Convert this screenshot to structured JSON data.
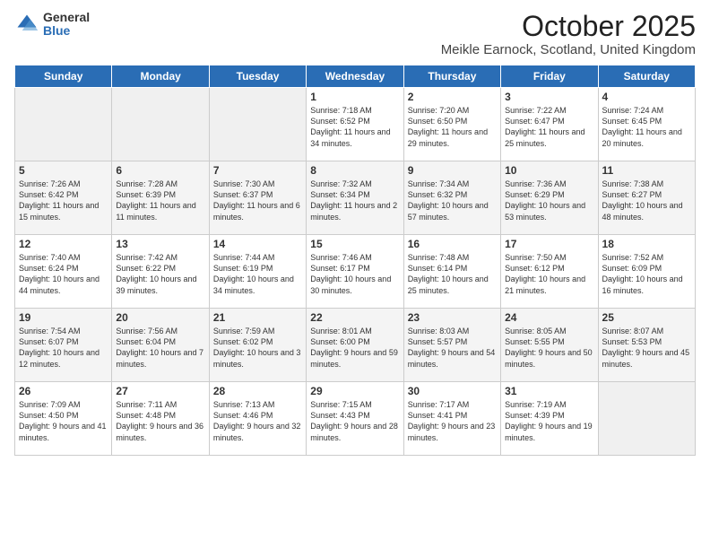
{
  "header": {
    "logo_general": "General",
    "logo_blue": "Blue",
    "month_title": "October 2025",
    "location": "Meikle Earnock, Scotland, United Kingdom"
  },
  "days_of_week": [
    "Sunday",
    "Monday",
    "Tuesday",
    "Wednesday",
    "Thursday",
    "Friday",
    "Saturday"
  ],
  "weeks": [
    [
      {
        "date": "",
        "text": ""
      },
      {
        "date": "",
        "text": ""
      },
      {
        "date": "",
        "text": ""
      },
      {
        "date": "1",
        "text": "Sunrise: 7:18 AM\nSunset: 6:52 PM\nDaylight: 11 hours\nand 34 minutes."
      },
      {
        "date": "2",
        "text": "Sunrise: 7:20 AM\nSunset: 6:50 PM\nDaylight: 11 hours\nand 29 minutes."
      },
      {
        "date": "3",
        "text": "Sunrise: 7:22 AM\nSunset: 6:47 PM\nDaylight: 11 hours\nand 25 minutes."
      },
      {
        "date": "4",
        "text": "Sunrise: 7:24 AM\nSunset: 6:45 PM\nDaylight: 11 hours\nand 20 minutes."
      }
    ],
    [
      {
        "date": "5",
        "text": "Sunrise: 7:26 AM\nSunset: 6:42 PM\nDaylight: 11 hours\nand 15 minutes."
      },
      {
        "date": "6",
        "text": "Sunrise: 7:28 AM\nSunset: 6:39 PM\nDaylight: 11 hours\nand 11 minutes."
      },
      {
        "date": "7",
        "text": "Sunrise: 7:30 AM\nSunset: 6:37 PM\nDaylight: 11 hours\nand 6 minutes."
      },
      {
        "date": "8",
        "text": "Sunrise: 7:32 AM\nSunset: 6:34 PM\nDaylight: 11 hours\nand 2 minutes."
      },
      {
        "date": "9",
        "text": "Sunrise: 7:34 AM\nSunset: 6:32 PM\nDaylight: 10 hours\nand 57 minutes."
      },
      {
        "date": "10",
        "text": "Sunrise: 7:36 AM\nSunset: 6:29 PM\nDaylight: 10 hours\nand 53 minutes."
      },
      {
        "date": "11",
        "text": "Sunrise: 7:38 AM\nSunset: 6:27 PM\nDaylight: 10 hours\nand 48 minutes."
      }
    ],
    [
      {
        "date": "12",
        "text": "Sunrise: 7:40 AM\nSunset: 6:24 PM\nDaylight: 10 hours\nand 44 minutes."
      },
      {
        "date": "13",
        "text": "Sunrise: 7:42 AM\nSunset: 6:22 PM\nDaylight: 10 hours\nand 39 minutes."
      },
      {
        "date": "14",
        "text": "Sunrise: 7:44 AM\nSunset: 6:19 PM\nDaylight: 10 hours\nand 34 minutes."
      },
      {
        "date": "15",
        "text": "Sunrise: 7:46 AM\nSunset: 6:17 PM\nDaylight: 10 hours\nand 30 minutes."
      },
      {
        "date": "16",
        "text": "Sunrise: 7:48 AM\nSunset: 6:14 PM\nDaylight: 10 hours\nand 25 minutes."
      },
      {
        "date": "17",
        "text": "Sunrise: 7:50 AM\nSunset: 6:12 PM\nDaylight: 10 hours\nand 21 minutes."
      },
      {
        "date": "18",
        "text": "Sunrise: 7:52 AM\nSunset: 6:09 PM\nDaylight: 10 hours\nand 16 minutes."
      }
    ],
    [
      {
        "date": "19",
        "text": "Sunrise: 7:54 AM\nSunset: 6:07 PM\nDaylight: 10 hours\nand 12 minutes."
      },
      {
        "date": "20",
        "text": "Sunrise: 7:56 AM\nSunset: 6:04 PM\nDaylight: 10 hours\nand 7 minutes."
      },
      {
        "date": "21",
        "text": "Sunrise: 7:59 AM\nSunset: 6:02 PM\nDaylight: 10 hours\nand 3 minutes."
      },
      {
        "date": "22",
        "text": "Sunrise: 8:01 AM\nSunset: 6:00 PM\nDaylight: 9 hours\nand 59 minutes."
      },
      {
        "date": "23",
        "text": "Sunrise: 8:03 AM\nSunset: 5:57 PM\nDaylight: 9 hours\nand 54 minutes."
      },
      {
        "date": "24",
        "text": "Sunrise: 8:05 AM\nSunset: 5:55 PM\nDaylight: 9 hours\nand 50 minutes."
      },
      {
        "date": "25",
        "text": "Sunrise: 8:07 AM\nSunset: 5:53 PM\nDaylight: 9 hours\nand 45 minutes."
      }
    ],
    [
      {
        "date": "26",
        "text": "Sunrise: 7:09 AM\nSunset: 4:50 PM\nDaylight: 9 hours\nand 41 minutes."
      },
      {
        "date": "27",
        "text": "Sunrise: 7:11 AM\nSunset: 4:48 PM\nDaylight: 9 hours\nand 36 minutes."
      },
      {
        "date": "28",
        "text": "Sunrise: 7:13 AM\nSunset: 4:46 PM\nDaylight: 9 hours\nand 32 minutes."
      },
      {
        "date": "29",
        "text": "Sunrise: 7:15 AM\nSunset: 4:43 PM\nDaylight: 9 hours\nand 28 minutes."
      },
      {
        "date": "30",
        "text": "Sunrise: 7:17 AM\nSunset: 4:41 PM\nDaylight: 9 hours\nand 23 minutes."
      },
      {
        "date": "31",
        "text": "Sunrise: 7:19 AM\nSunset: 4:39 PM\nDaylight: 9 hours\nand 19 minutes."
      },
      {
        "date": "",
        "text": ""
      }
    ]
  ]
}
